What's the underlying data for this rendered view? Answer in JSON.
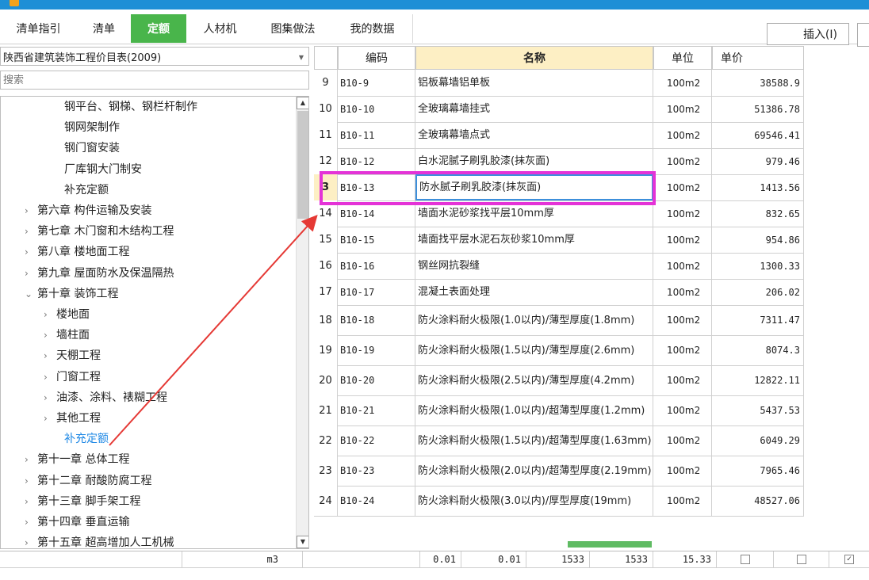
{
  "tabs": [
    {
      "label": "清单指引",
      "active": false
    },
    {
      "label": "清单",
      "active": false
    },
    {
      "label": "定额",
      "active": true
    },
    {
      "label": "人材机",
      "active": false
    },
    {
      "label": "图集做法",
      "active": false
    },
    {
      "label": "我的数据",
      "active": false
    }
  ],
  "toolbar": {
    "insert_label": "插入(I)"
  },
  "left": {
    "dropdown_value": "陕西省建筑装饰工程价目表(2009)",
    "search_placeholder": "搜索",
    "tree": [
      {
        "label": "钢平台、钢梯、钢栏杆制作",
        "arrow": ""
      },
      {
        "label": "钢网架制作",
        "arrow": ""
      },
      {
        "label": "钢门窗安装",
        "arrow": ""
      },
      {
        "label": "厂库钢大门制安",
        "arrow": ""
      },
      {
        "label": "补充定额",
        "arrow": ""
      },
      {
        "label": "第六章 构件运输及安装",
        "arrow": ">"
      },
      {
        "label": "第七章 木门窗和木结构工程",
        "arrow": ">"
      },
      {
        "label": "第八章 楼地面工程",
        "arrow": ">"
      },
      {
        "label": "第九章 屋面防水及保温隔热",
        "arrow": ">"
      },
      {
        "label": "第十章 装饰工程",
        "arrow": "v"
      },
      {
        "label": "楼地面",
        "arrow": ">"
      },
      {
        "label": "墙柱面",
        "arrow": ">"
      },
      {
        "label": "天棚工程",
        "arrow": ">"
      },
      {
        "label": "门窗工程",
        "arrow": ">"
      },
      {
        "label": "油漆、涂料、裱糊工程",
        "arrow": ">"
      },
      {
        "label": "其他工程",
        "arrow": ">"
      },
      {
        "label": "补充定额",
        "arrow": ""
      },
      {
        "label": "第十一章 总体工程",
        "arrow": ">"
      },
      {
        "label": "第十二章 耐酸防腐工程",
        "arrow": ">"
      },
      {
        "label": "第十三章 脚手架工程",
        "arrow": ">"
      },
      {
        "label": "第十四章 垂直运输",
        "arrow": ">"
      },
      {
        "label": "第十五章 超高增加人工机械",
        "arrow": ">"
      }
    ]
  },
  "table": {
    "headers": {
      "code": "编码",
      "name": "名称",
      "unit": "单位",
      "price": "单价"
    },
    "rows": [
      {
        "idx": "9",
        "code": "B10-9",
        "name": "铝板幕墙铝单板",
        "unit": "100m2",
        "price": "38588.9"
      },
      {
        "idx": "10",
        "code": "B10-10",
        "name": "全玻璃幕墙挂式",
        "unit": "100m2",
        "price": "51386.78"
      },
      {
        "idx": "11",
        "code": "B10-11",
        "name": "全玻璃幕墙点式",
        "unit": "100m2",
        "price": "69546.41"
      },
      {
        "idx": "12",
        "code": "B10-12",
        "name": "白水泥腻子刷乳胶漆(抹灰面)",
        "unit": "100m2",
        "price": "979.46"
      },
      {
        "idx": "3",
        "code": "B10-13",
        "name": "防水腻子刷乳胶漆(抹灰面)",
        "unit": "100m2",
        "price": "1413.56"
      },
      {
        "idx": "14",
        "code": "B10-14",
        "name": "墙面水泥砂浆找平层10mm厚",
        "unit": "100m2",
        "price": "832.65"
      },
      {
        "idx": "15",
        "code": "B10-15",
        "name": "墙面找平层水泥石灰砂浆10mm厚",
        "unit": "100m2",
        "price": "954.86"
      },
      {
        "idx": "16",
        "code": "B10-16",
        "name": "钢丝网抗裂缝",
        "unit": "100m2",
        "price": "1300.33"
      },
      {
        "idx": "17",
        "code": "B10-17",
        "name": "混凝土表面处理",
        "unit": "100m2",
        "price": "206.02"
      },
      {
        "idx": "18",
        "code": "B10-18",
        "name": "防火涂料耐火极限(1.0以内)/薄型厚度(1.8mm)",
        "unit": "100m2",
        "price": "7311.47"
      },
      {
        "idx": "19",
        "code": "B10-19",
        "name": "防火涂料耐火极限(1.5以内)/薄型厚度(2.6mm)",
        "unit": "100m2",
        "price": "8074.3"
      },
      {
        "idx": "20",
        "code": "B10-20",
        "name": "防火涂料耐火极限(2.5以内)/薄型厚度(4.2mm)",
        "unit": "100m2",
        "price": "12822.11"
      },
      {
        "idx": "21",
        "code": "B10-21",
        "name": "防火涂料耐火极限(1.0以内)/超薄型厚度(1.2mm)",
        "unit": "100m2",
        "price": "5437.53"
      },
      {
        "idx": "22",
        "code": "B10-22",
        "name": "防火涂料耐火极限(1.5以内)/超薄型厚度(1.63mm)",
        "unit": "100m2",
        "price": "6049.29"
      },
      {
        "idx": "23",
        "code": "B10-23",
        "name": "防火涂料耐火极限(2.0以内)/超薄型厚度(2.19mm)",
        "unit": "100m2",
        "price": "7965.46"
      },
      {
        "idx": "24",
        "code": "B10-24",
        "name": "防火涂料耐火极限(3.0以内)/厚型厚度(19mm)",
        "unit": "100m2",
        "price": "48527.06"
      }
    ]
  },
  "bottom_row": {
    "unit": "m3",
    "v1": "0.01",
    "v2": "0.01",
    "v3": "1533",
    "v4": "1533",
    "v5": "15.33",
    "check3": "✓"
  },
  "colors": {
    "accent": "#49b54b",
    "highlight": "#e433d7",
    "arrow": "#e53935",
    "header_name": "#fdefc4"
  }
}
